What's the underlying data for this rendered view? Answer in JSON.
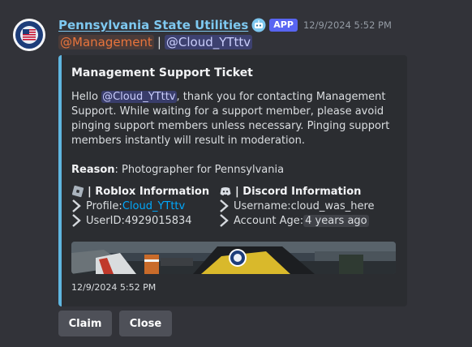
{
  "message": {
    "author": "Pennsylvania State Utilities",
    "badge": "APP",
    "timestamp": "12/9/2024 5:52 PM",
    "role_mention": "@Management",
    "separator": "|",
    "user_mention": "@Cloud_YTttv"
  },
  "embed": {
    "accent_color": "#5fb6e0",
    "title": "Management Support Ticket",
    "desc_hello": "Hello ",
    "desc_mention": "@Cloud_YTttv",
    "desc_rest": ", thank you for contacting Management Support. While waiting for a support member, please avoid pinging support members unless necessary. Pinging support members instantly will result in moderation.",
    "reason_label": "Reason",
    "reason_value": ": Photographer for Pennsylvania",
    "roblox": {
      "name": "| Roblox Information",
      "icon": "roblox-icon",
      "profile_label": "Profile: ",
      "profile_value": "Cloud_YTttv",
      "userid_label": "UserID: ",
      "userid_value": "4929015834"
    },
    "discord": {
      "name": "| Discord Information",
      "icon": "discord-icon",
      "username_label": "Username: ",
      "username_value": "cloud_was_here",
      "age_label": "Account Age: ",
      "age_value": "4 years ago"
    },
    "footer": "12/9/2024 5:52 PM"
  },
  "buttons": {
    "claim": "Claim",
    "close": "Close"
  }
}
